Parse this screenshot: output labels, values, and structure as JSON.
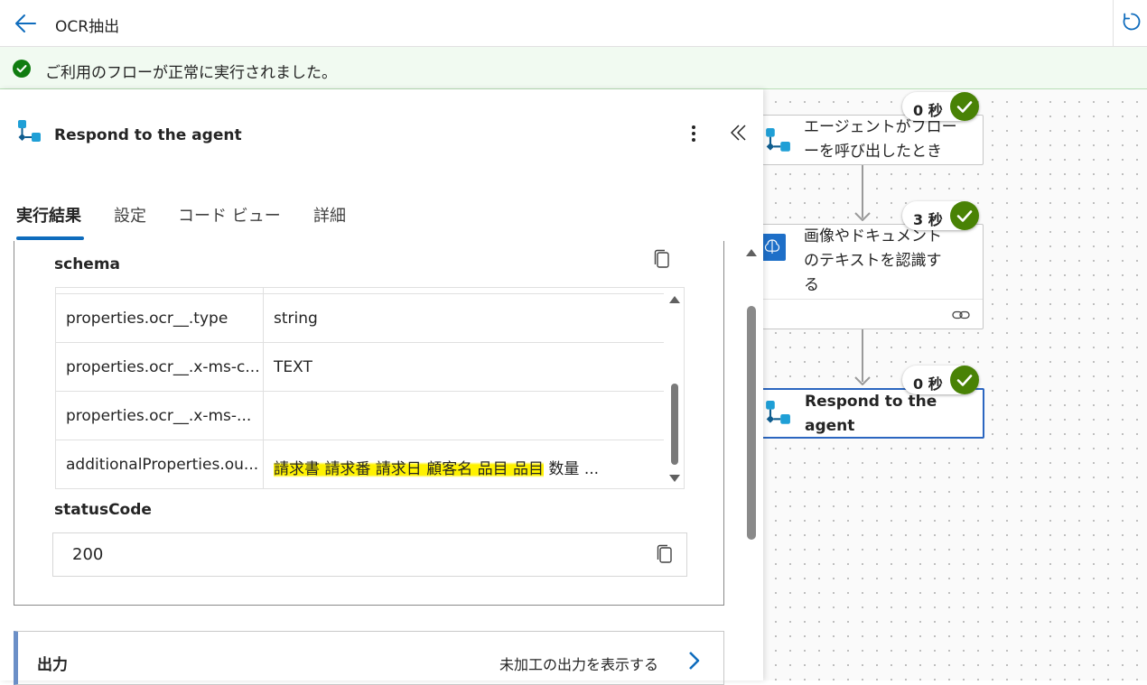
{
  "header": {
    "title": "OCR抽出",
    "back_icon": "arrow-left-icon",
    "refresh_icon": "refresh-icon"
  },
  "banner": {
    "text": "ご利用のフローが正常に実行されました。",
    "icon": "success-check-icon",
    "color": "#107c10"
  },
  "panel": {
    "title": "Respond to the agent",
    "tabs": [
      {
        "label": "実行結果",
        "active": true
      },
      {
        "label": "設定",
        "active": false
      },
      {
        "label": "コード ビュー",
        "active": false
      },
      {
        "label": "詳細",
        "active": false
      }
    ],
    "schema": {
      "label": "schema",
      "rows": [
        {
          "key": "properties.ocr__.type",
          "value": "string"
        },
        {
          "key": "properties.ocr__.x-ms-c...",
          "value": "TEXT"
        },
        {
          "key": "properties.ocr__.x-ms-...",
          "value": ""
        },
        {
          "key": "additionalProperties.ou...",
          "value_highlighted": "請求書 請求番 請求日 顧客名 品目 品目",
          "value_rest": " 数量 ..."
        }
      ]
    },
    "status": {
      "label": "statusCode",
      "value": "200"
    },
    "output": {
      "label": "出力",
      "link": "未加工の出力を表示する"
    }
  },
  "canvas": {
    "nodes": [
      {
        "line1": "エージェントがフロー",
        "line2": "ーを呼び出したとき",
        "duration": "0 秒",
        "status": "succeeded"
      },
      {
        "line1": "画像やドキュメント",
        "line2": "のテキストを認識す",
        "line3": "る",
        "duration": "3 秒",
        "status": "succeeded"
      },
      {
        "line1": "Respond to the",
        "line2": "agent",
        "duration": "0 秒",
        "status": "succeeded",
        "selected": true
      }
    ]
  },
  "colors": {
    "accent": "#0f6cbd",
    "success": "#107c10",
    "highlight": "#fff200",
    "node_selected": "#2b66c0"
  }
}
